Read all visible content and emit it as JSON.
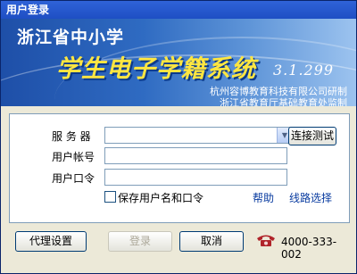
{
  "window": {
    "title": "用户登录"
  },
  "banner": {
    "line1": "浙江省中小学",
    "line2": "学生电子学籍系统",
    "version": "3.1.299",
    "credit1": "杭州容博教育科技有限公司研制",
    "credit2": "浙江省教育厅基础教育处监制"
  },
  "form": {
    "server_label": "服 务 器",
    "server_value": "",
    "test_button": "连接测试",
    "account_label": "用户帐号",
    "account_value": "",
    "password_label": "用户口令",
    "password_value": "",
    "save_label": "保存用户名和口令",
    "help_link": "帮助",
    "route_link": "线路选择"
  },
  "footer": {
    "proxy_button": "代理设置",
    "login_button": "登录",
    "cancel_button": "取消",
    "phone_icon": "telephone-icon",
    "phone_number": "4000-333-002"
  }
}
